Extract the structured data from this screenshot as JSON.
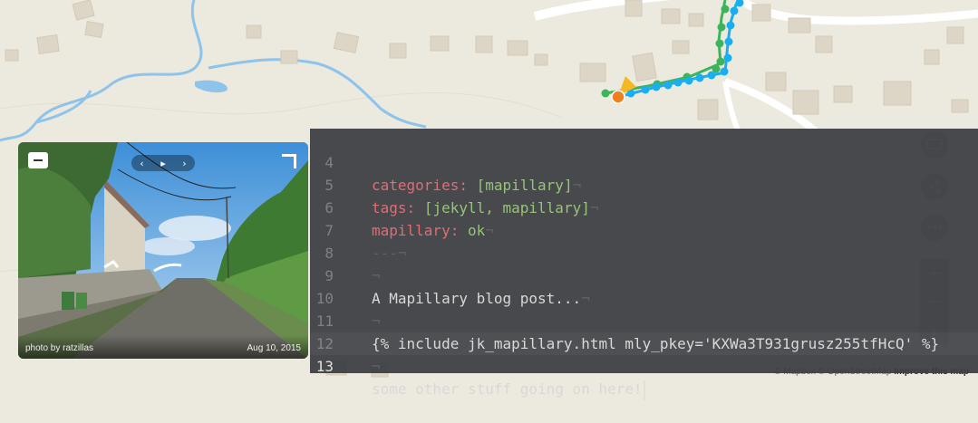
{
  "map": {
    "attribution": {
      "mapbox": "© Mapbox",
      "osm": "© OpenStreetMap",
      "improve": "Improve this map"
    },
    "controls": {
      "zoom_in": "+",
      "compass": "▲"
    },
    "colors": {
      "land": "#ece9df",
      "river": "#8ec3ea",
      "road": "#ffffff",
      "building": "#ddd6c6",
      "sequence_green": "#3cb45a",
      "sequence_blue": "#18aef0",
      "current_point": "#f07f22",
      "view_cone": "#f6b820"
    }
  },
  "viewer": {
    "credit": "photo by ratzillas",
    "date": "Aug 10, 2015",
    "nav": {
      "prev": "‹",
      "play": "▸",
      "next": "›"
    }
  },
  "editor": {
    "lines": [
      {
        "num": "4",
        "key": "categories:",
        "val": "[mapillary]",
        "eol": "¬"
      },
      {
        "num": "5",
        "key": "tags:",
        "val": "[jekyll, mapillary]",
        "eol": "¬"
      },
      {
        "num": "6",
        "key": "mapillary:",
        "val": "ok",
        "eol": "¬"
      },
      {
        "num": "7",
        "text": "---",
        "eol": "¬"
      },
      {
        "num": "8",
        "eol": "¬"
      },
      {
        "num": "9",
        "text": "A Mapillary blog post...",
        "eol": "¬"
      },
      {
        "num": "10",
        "eol": "¬"
      },
      {
        "num": "11",
        "text": "{% include jk_mapillary.html mly_pkey='KXWa3T931grusz255tfHcQ' %}"
      },
      {
        "num": "12",
        "eol": "¬"
      },
      {
        "num": "13",
        "text": "some other stuff going on here!"
      }
    ]
  }
}
